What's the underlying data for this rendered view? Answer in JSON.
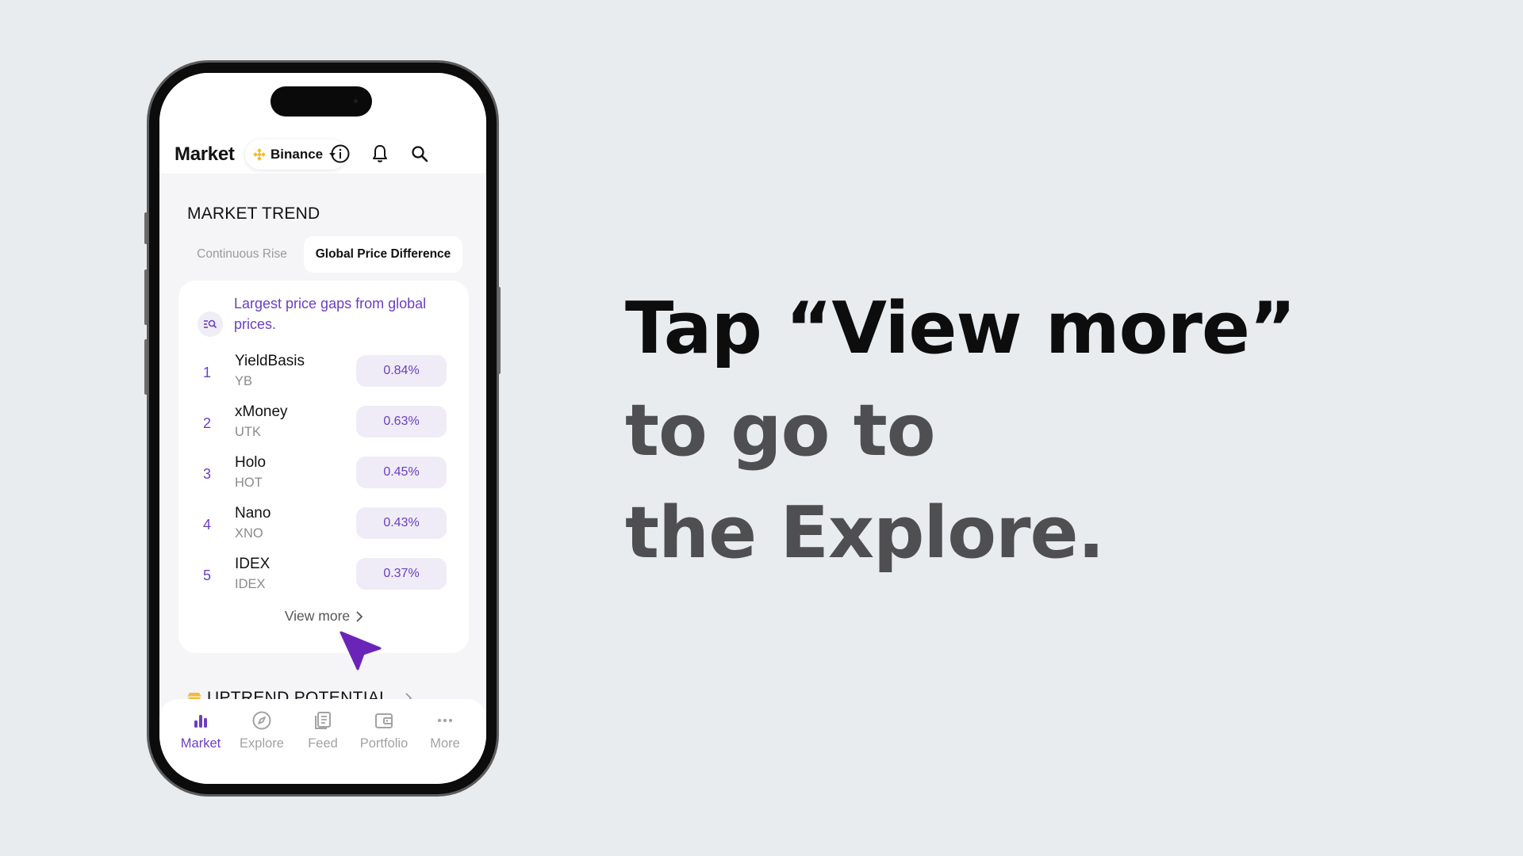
{
  "header": {
    "title": "Market",
    "exchange": "Binance"
  },
  "section": {
    "title": "MARKET TREND",
    "tabs": [
      {
        "label": "Continuous Rise",
        "active": false
      },
      {
        "label": "Global Price Difference",
        "active": true
      }
    ]
  },
  "card": {
    "description": "Largest price gaps from global prices.",
    "rows": [
      {
        "rank": "1",
        "name": "YieldBasis",
        "symbol": "YB",
        "gap": "0.84%"
      },
      {
        "rank": "2",
        "name": "xMoney",
        "symbol": "UTK",
        "gap": "0.63%"
      },
      {
        "rank": "3",
        "name": "Holo",
        "symbol": "HOT",
        "gap": "0.45%"
      },
      {
        "rank": "4",
        "name": "Nano",
        "symbol": "XNO",
        "gap": "0.43%"
      },
      {
        "rank": "5",
        "name": "IDEX",
        "symbol": "IDEX",
        "gap": "0.37%"
      }
    ],
    "view_more": "View more"
  },
  "next_section": {
    "title": "UPTREND POTENTIAL"
  },
  "tabbar": [
    {
      "label": "Market",
      "icon": "bar-chart-icon",
      "active": true
    },
    {
      "label": "Explore",
      "icon": "compass-icon",
      "active": false
    },
    {
      "label": "Feed",
      "icon": "news-icon",
      "active": false
    },
    {
      "label": "Portfolio",
      "icon": "wallet-icon",
      "active": false
    },
    {
      "label": "More",
      "icon": "more-dots-icon",
      "active": false
    }
  ],
  "caption": {
    "line1": "Tap “View more”",
    "line2": "to go to",
    "line3": "the Explore."
  },
  "colors": {
    "accent": "#6b3fc2",
    "exchange_brand": "#f3ba2f",
    "background": "#e9ecef"
  }
}
